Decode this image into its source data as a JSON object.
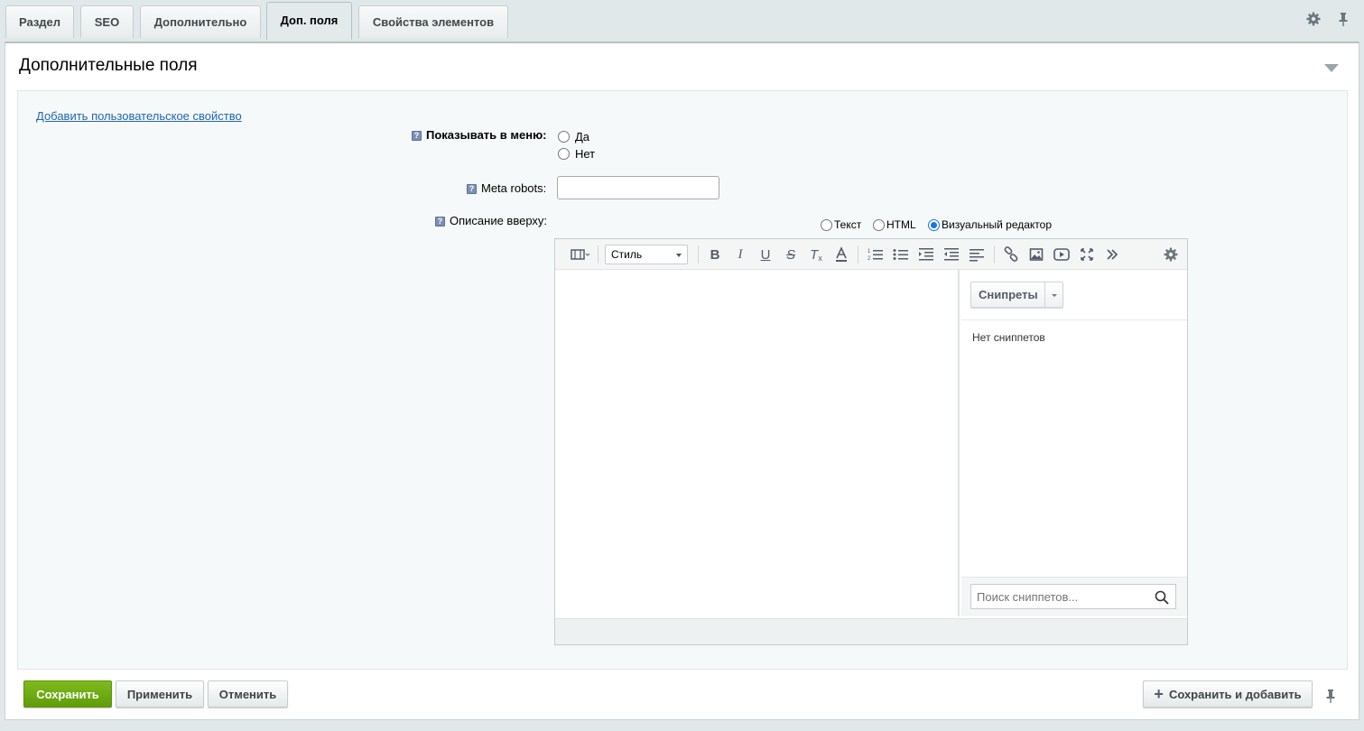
{
  "tabs": [
    {
      "label": "Раздел"
    },
    {
      "label": "SEO"
    },
    {
      "label": "Дополнительно"
    },
    {
      "label": "Доп. поля"
    },
    {
      "label": "Свойства элементов"
    }
  ],
  "section": {
    "title": "Дополнительные поля",
    "add_property_link": "Добавить пользовательское свойство"
  },
  "fields": {
    "show_in_menu": {
      "label": "Показывать в меню",
      "options": [
        "Да",
        "Нет"
      ],
      "selected": null
    },
    "meta_robots": {
      "label": "Meta robots",
      "value": ""
    },
    "description_top": {
      "label": "Описание вверху",
      "modes": [
        "Текст",
        "HTML",
        "Визуальный редактор"
      ],
      "selected_mode": "Визуальный редактор"
    }
  },
  "editor": {
    "style_select": "Стиль",
    "snippets_button": "Снипреты",
    "no_snippets": "Нет сниппетов",
    "search_placeholder": "Поиск сниппетов...",
    "toolbar_icons": [
      "source-icon",
      "bold-icon",
      "italic-icon",
      "underline-icon",
      "strikethrough-icon",
      "remove-format-icon",
      "font-color-icon",
      "ordered-list-icon",
      "unordered-list-icon",
      "indent-icon",
      "outdent-icon",
      "align-left-icon",
      "link-icon",
      "image-icon",
      "video-icon",
      "fullscreen-icon",
      "more-icon",
      "settings-icon"
    ]
  },
  "footer": {
    "save": "Сохранить",
    "apply": "Применить",
    "cancel": "Отменить",
    "save_and_add": "Сохранить и добавить"
  },
  "colors": {
    "accent_green": "#6aaa10",
    "link_blue": "#2067b0",
    "panel_bg": "#e0e8ea"
  }
}
